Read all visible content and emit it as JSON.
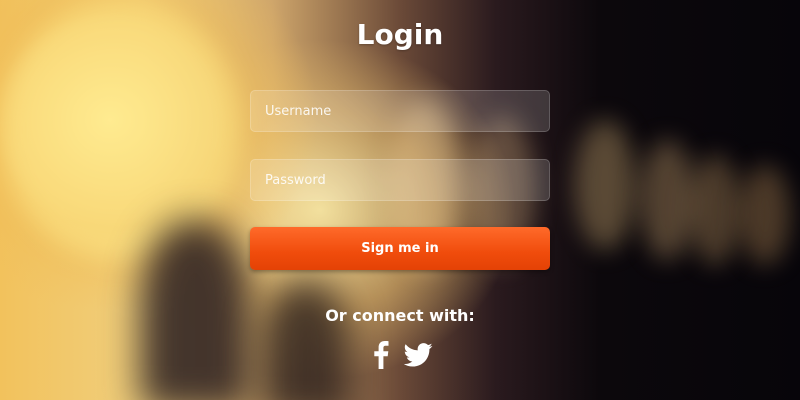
{
  "page": {
    "title": "Login"
  },
  "form": {
    "username_placeholder": "Username",
    "username_value": "",
    "password_placeholder": "Password",
    "password_value": "",
    "submit_label": "Sign me in"
  },
  "social": {
    "label": "Or connect with:",
    "providers": [
      {
        "name": "Facebook",
        "icon": "facebook-icon"
      },
      {
        "name": "Twitter",
        "icon": "twitter-icon"
      }
    ]
  },
  "colors": {
    "accent": "#f04c0c",
    "text": "#ffffff"
  }
}
